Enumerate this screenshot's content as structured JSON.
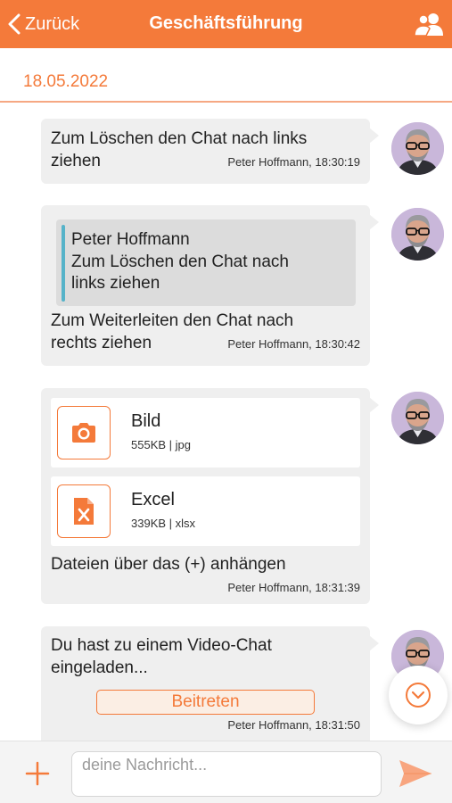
{
  "header": {
    "back_label": "Zurück",
    "title": "Geschäftsführung",
    "background": "#f47a3a",
    "back_icon": "chevron-left-icon",
    "group_icon": "users-icon"
  },
  "date_separator": "18.05.2022",
  "messages": [
    {
      "text_lines": [
        "Zum Löschen den Chat nach links",
        "ziehen"
      ],
      "meta": "Peter Hoffmann, 18:30:19"
    },
    {
      "quote": {
        "author": "Peter Hoffmann",
        "lines": [
          "Zum Löschen den Chat nach",
          "links ziehen"
        ]
      },
      "text_lines": [
        "Zum Weiterleiten den Chat nach",
        "rechts ziehen"
      ],
      "meta": "Peter Hoffmann, 18:30:42"
    },
    {
      "files": [
        {
          "name": "Bild",
          "info": "555KB | jpg",
          "icon": "camera-icon"
        },
        {
          "name": "Excel",
          "info": "339KB | xlsx",
          "icon": "excel-file-icon"
        }
      ],
      "text_lines": [
        "Dateien über das (+) anhängen"
      ],
      "meta": "Peter Hoffmann, 18:31:39"
    },
    {
      "text_lines": [
        "Du hast zu einem Video-Chat",
        "eingeladen..."
      ],
      "button_label": "Beitreten",
      "meta": "Peter Hoffmann, 18:31:50"
    }
  ],
  "composer": {
    "placeholder": "deine Nachricht...",
    "value": "",
    "add_icon": "plus-icon",
    "send_icon": "send-icon"
  },
  "scroll_down_icon": "chevron-down-circle-icon",
  "colors": {
    "accent": "#f47a3a",
    "bubble": "#efefef",
    "quote_bar": "#56b3c9"
  }
}
